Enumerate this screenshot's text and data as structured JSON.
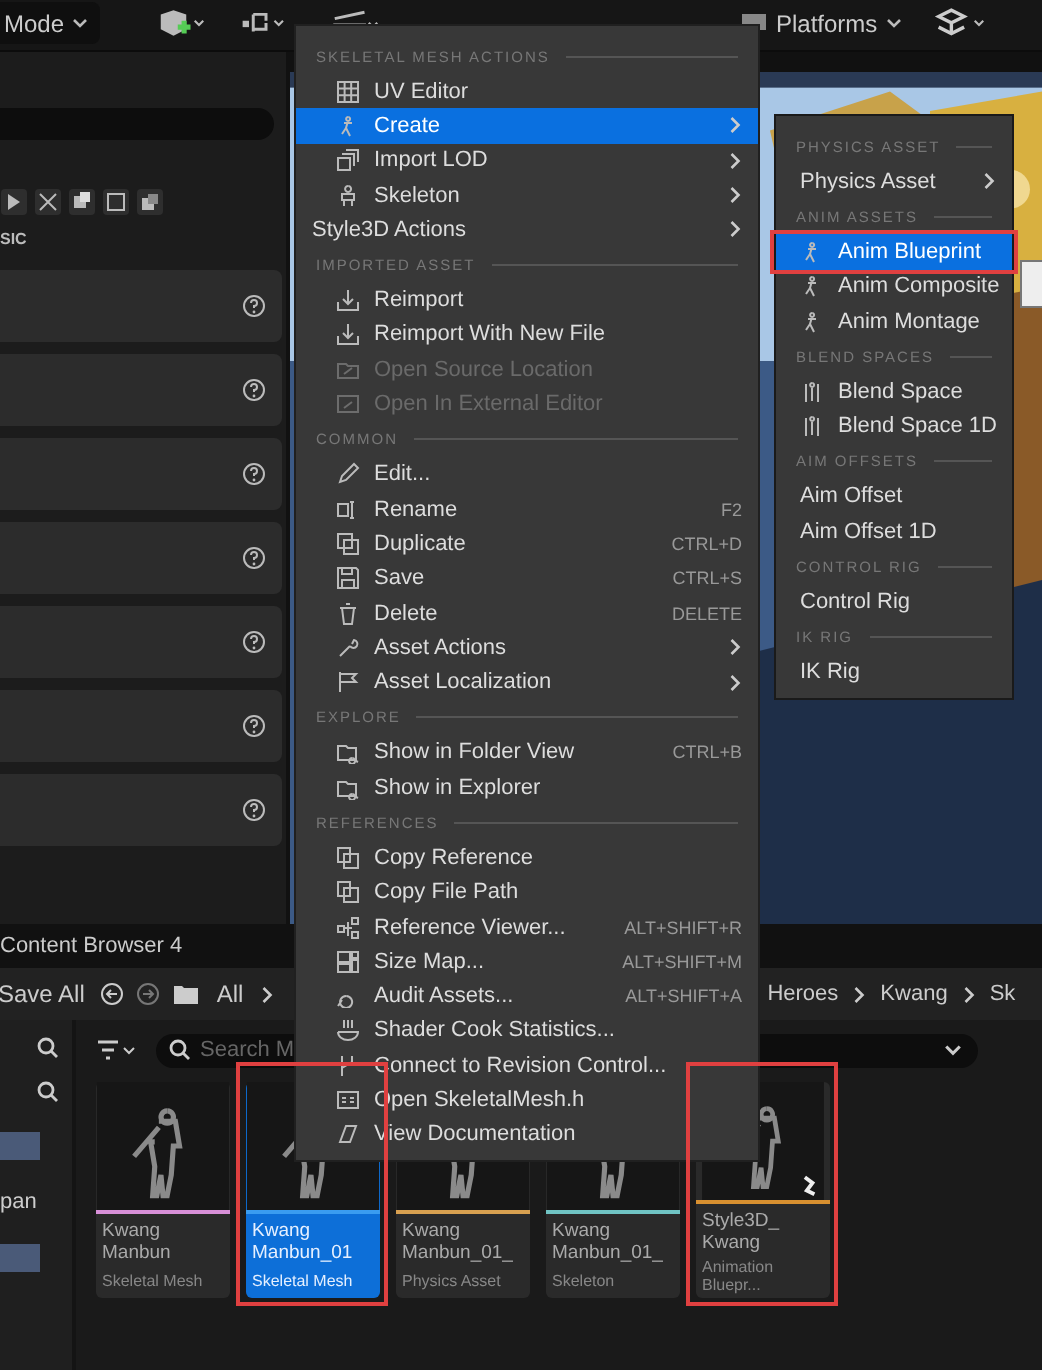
{
  "toolbar": {
    "mode": "Mode",
    "platforms": "Platforms"
  },
  "left_panel": {
    "label": "SIC"
  },
  "context_menu": {
    "sections": [
      {
        "header": "SKELETAL MESH ACTIONS",
        "items": [
          {
            "kind": "uv-editor",
            "label": "UV Editor",
            "disabled": false,
            "selected": false
          },
          {
            "kind": "create",
            "label": "Create",
            "submenu": true,
            "disabled": false,
            "selected": true
          },
          {
            "kind": "import-lod",
            "label": "Import LOD",
            "submenu": true,
            "disabled": false,
            "selected": false
          },
          {
            "kind": "skeleton",
            "label": "Skeleton",
            "submenu": true,
            "disabled": false,
            "selected": false
          },
          {
            "kind": "plain",
            "label": "Style3D Actions",
            "submenu": true,
            "disabled": false,
            "selected": false
          }
        ]
      },
      {
        "header": "IMPORTED ASSET",
        "items": [
          {
            "kind": "reimport",
            "label": "Reimport",
            "disabled": false,
            "selected": false
          },
          {
            "kind": "reimport",
            "label": "Reimport With New File",
            "disabled": false,
            "selected": false
          },
          {
            "kind": "source",
            "label": "Open Source Location",
            "disabled": true,
            "selected": false
          },
          {
            "kind": "external",
            "label": "Open In External Editor",
            "disabled": true,
            "selected": false
          }
        ]
      },
      {
        "header": "COMMON",
        "items": [
          {
            "kind": "edit",
            "label": "Edit...",
            "disabled": false,
            "selected": false
          },
          {
            "kind": "rename",
            "label": "Rename",
            "shortcut": "F2",
            "disabled": false,
            "selected": false
          },
          {
            "kind": "duplicate",
            "label": "Duplicate",
            "shortcut": "CTRL+D",
            "disabled": false,
            "selected": false
          },
          {
            "kind": "save",
            "label": "Save",
            "shortcut": "CTRL+S",
            "disabled": false,
            "selected": false
          },
          {
            "kind": "delete",
            "label": "Delete",
            "shortcut": "DELETE",
            "disabled": false,
            "selected": false
          },
          {
            "kind": "asset-actions",
            "label": "Asset Actions",
            "submenu": true,
            "disabled": false,
            "selected": false
          },
          {
            "kind": "localization",
            "label": "Asset Localization",
            "submenu": true,
            "disabled": false,
            "selected": false
          }
        ]
      },
      {
        "header": "EXPLORE",
        "items": [
          {
            "kind": "folder-view",
            "label": "Show in Folder View",
            "shortcut": "CTRL+B",
            "disabled": false,
            "selected": false
          },
          {
            "kind": "folder-view",
            "label": "Show in Explorer",
            "disabled": false,
            "selected": false
          }
        ]
      },
      {
        "header": "REFERENCES",
        "items": [
          {
            "kind": "copy",
            "label": "Copy Reference",
            "disabled": false,
            "selected": false
          },
          {
            "kind": "copy",
            "label": "Copy File Path",
            "disabled": false,
            "selected": false
          },
          {
            "kind": "reference-viewer",
            "label": "Reference Viewer...",
            "shortcut": "ALT+SHIFT+R",
            "disabled": false,
            "selected": false
          },
          {
            "kind": "size-map",
            "label": "Size Map...",
            "shortcut": "ALT+SHIFT+M",
            "disabled": false,
            "selected": false
          },
          {
            "kind": "audit",
            "label": "Audit Assets...",
            "shortcut": "ALT+SHIFT+A",
            "disabled": false,
            "selected": false
          },
          {
            "kind": "shader",
            "label": "Shader Cook Statistics...",
            "disabled": false,
            "selected": false
          },
          {
            "kind": "revision",
            "label": "Connect to Revision Control...",
            "disabled": false,
            "selected": false
          },
          {
            "kind": "header-file",
            "label": "Open SkeletalMesh.h",
            "disabled": false,
            "selected": false
          },
          {
            "kind": "documentation",
            "label": "View Documentation",
            "disabled": false,
            "selected": false
          }
        ]
      }
    ]
  },
  "submenu": {
    "sections": [
      {
        "header": "PHYSICS ASSET",
        "items": [
          {
            "kind": "plain",
            "label": "Physics Asset",
            "submenu": true,
            "selected": false
          }
        ]
      },
      {
        "header": "ANIM ASSETS",
        "items": [
          {
            "kind": "anim",
            "label": "Anim Blueprint",
            "selected": true,
            "highlighted": true
          },
          {
            "kind": "anim",
            "label": "Anim Composite",
            "selected": false
          },
          {
            "kind": "anim",
            "label": "Anim Montage",
            "selected": false
          }
        ]
      },
      {
        "header": "BLEND SPACES",
        "items": [
          {
            "kind": "blend",
            "label": "Blend Space",
            "selected": false
          },
          {
            "kind": "blend",
            "label": "Blend Space 1D",
            "selected": false
          }
        ]
      },
      {
        "header": "AIM OFFSETS",
        "items": [
          {
            "kind": "plain",
            "label": "Aim Offset",
            "selected": false
          },
          {
            "kind": "plain",
            "label": "Aim Offset 1D",
            "selected": false
          }
        ]
      },
      {
        "header": "CONTROL RIG",
        "items": [
          {
            "kind": "plain",
            "label": "Control Rig",
            "selected": false
          }
        ]
      },
      {
        "header": "IK RIG",
        "items": [
          {
            "kind": "plain",
            "label": "IK Rig",
            "selected": false
          }
        ]
      }
    ]
  },
  "content_browser": {
    "tab": "Content Browser 4",
    "save_all": "Save All",
    "path_start": "All",
    "breadcrumbs": [
      "Heroes",
      "Kwang",
      "Sk"
    ],
    "search": {
      "placeholder": "Search M"
    },
    "sidebar": [
      {
        "selected": true
      },
      {
        "label": "pan",
        "selected": false
      },
      {
        "selected": true
      }
    ],
    "assets": [
      {
        "name": "Kwang Manbun",
        "type": "Skeletal Mesh",
        "color": "#d890d8",
        "selected": false
      },
      {
        "name": "Kwang Manbun_01",
        "type": "Skeletal Mesh",
        "color": "#3a9cf0",
        "selected": true,
        "highlighted": true
      },
      {
        "name": "Kwang Manbun_01_",
        "type": "Physics Asset",
        "color": "#d8a050",
        "selected": false
      },
      {
        "name": "Kwang Manbun_01_",
        "type": "Skeleton",
        "color": "#70c4c4",
        "selected": false
      },
      {
        "name": "Style3D_ Kwang",
        "type": "Animation Bluepr...",
        "color": "#d89030",
        "selected": false,
        "highlighted": true
      }
    ]
  }
}
